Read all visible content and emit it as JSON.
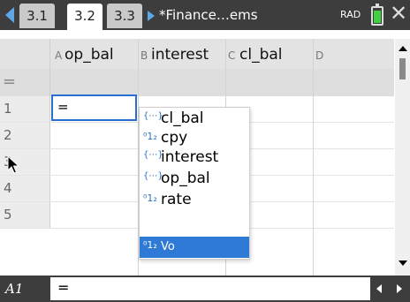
{
  "tabs": [
    "3.1",
    "3.2",
    "3.3"
  ],
  "document_title": "*Finance…ems",
  "angle_mode": "RAD",
  "columns": [
    {
      "letter": "A",
      "name": "op_bal"
    },
    {
      "letter": "B",
      "name": "interest"
    },
    {
      "letter": "C",
      "name": "cl_bal"
    },
    {
      "letter": "D",
      "name": ""
    }
  ],
  "formula_row_symbol": "=",
  "rows": [
    "1",
    "2",
    "3",
    "4",
    "5"
  ],
  "active_cell_text": "=",
  "autocomplete": [
    {
      "icon": "list-icon",
      "glyph": "{⋯}",
      "label": "cl_bal"
    },
    {
      "icon": "number-icon",
      "glyph": "⁰1₂",
      "label": "cpy"
    },
    {
      "icon": "list-icon",
      "glyph": "{⋯}",
      "label": "interest"
    },
    {
      "icon": "list-icon",
      "glyph": "{⋯}",
      "label": "op_bal"
    },
    {
      "icon": "number-icon",
      "glyph": "⁰1₂",
      "label": "rate"
    },
    {
      "icon": "number-icon",
      "glyph": "⁰1₂",
      "label": "Vo",
      "selected": true
    }
  ],
  "formula_bar": {
    "cell_ref": "A1",
    "content": "="
  },
  "colors": {
    "accent": "#2e7ad6",
    "topbar": "#3d3d3d",
    "battery": "#3fd13f"
  }
}
